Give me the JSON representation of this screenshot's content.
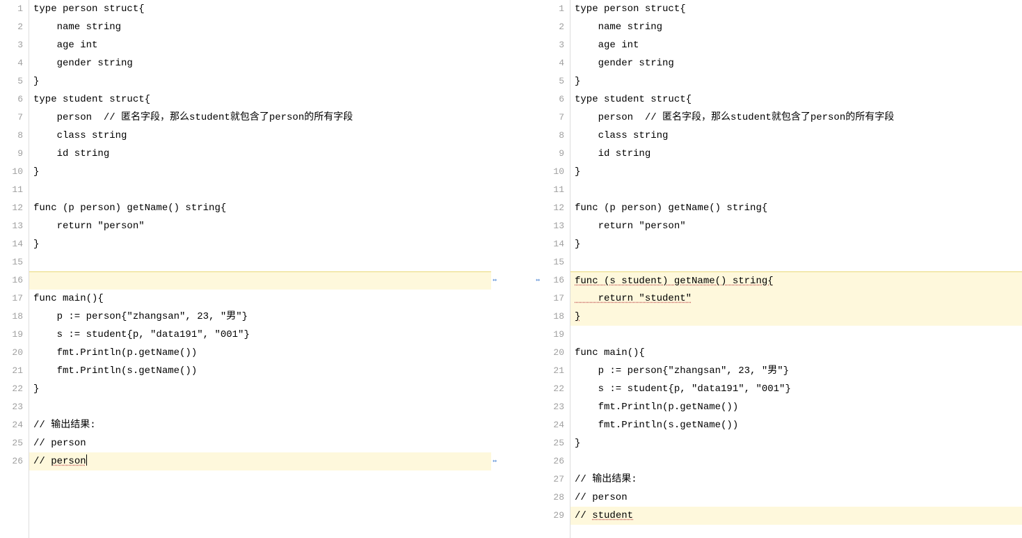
{
  "left": {
    "lines": [
      {
        "n": "1",
        "txt": "type person struct{",
        "cls": ""
      },
      {
        "n": "2",
        "txt": "    name string",
        "cls": ""
      },
      {
        "n": "3",
        "txt": "    age int",
        "cls": ""
      },
      {
        "n": "4",
        "txt": "    gender string",
        "cls": ""
      },
      {
        "n": "5",
        "txt": "}",
        "cls": ""
      },
      {
        "n": "6",
        "txt": "type student struct{",
        "cls": ""
      },
      {
        "n": "7",
        "txt": "    person  // 匿名字段，那么student就包含了person的所有字段",
        "cls": ""
      },
      {
        "n": "8",
        "txt": "    class string",
        "cls": ""
      },
      {
        "n": "9",
        "txt": "    id string",
        "cls": ""
      },
      {
        "n": "10",
        "txt": "}",
        "cls": ""
      },
      {
        "n": "11",
        "txt": "",
        "cls": ""
      },
      {
        "n": "12",
        "txt": "func (p person) getName() string{",
        "cls": ""
      },
      {
        "n": "13",
        "txt": "    return \"person\"",
        "cls": ""
      },
      {
        "n": "14",
        "txt": "}",
        "cls": ""
      },
      {
        "n": "15",
        "txt": "",
        "cls": ""
      },
      {
        "n": "16",
        "txt": "",
        "cls": "hl-yellow hl-sep-above"
      },
      {
        "n": "17",
        "txt": "func main(){",
        "cls": ""
      },
      {
        "n": "18",
        "txt": "    p := person{\"zhangsan\", 23, \"男\"}",
        "cls": ""
      },
      {
        "n": "19",
        "txt": "    s := student{p, \"data191\", \"001\"}",
        "cls": ""
      },
      {
        "n": "20",
        "txt": "    fmt.Println(p.getName())",
        "cls": ""
      },
      {
        "n": "21",
        "txt": "    fmt.Println(s.getName())",
        "cls": ""
      },
      {
        "n": "22",
        "txt": "}",
        "cls": ""
      },
      {
        "n": "23",
        "txt": "",
        "cls": ""
      },
      {
        "n": "24",
        "txt": "// 输出结果:",
        "cls": ""
      },
      {
        "n": "25",
        "txt": "// person",
        "cls": ""
      },
      {
        "n": "26",
        "txt": "",
        "cls": "hl-yellow-mod",
        "pre": "// ",
        "mod": "person",
        "caret": true
      }
    ]
  },
  "right": {
    "lines": [
      {
        "n": "1",
        "txt": "type person struct{",
        "cls": ""
      },
      {
        "n": "2",
        "txt": "    name string",
        "cls": ""
      },
      {
        "n": "3",
        "txt": "    age int",
        "cls": ""
      },
      {
        "n": "4",
        "txt": "    gender string",
        "cls": ""
      },
      {
        "n": "5",
        "txt": "}",
        "cls": ""
      },
      {
        "n": "6",
        "txt": "type student struct{",
        "cls": ""
      },
      {
        "n": "7",
        "txt": "    person  // 匿名字段，那么student就包含了person的所有字段",
        "cls": ""
      },
      {
        "n": "8",
        "txt": "    class string",
        "cls": ""
      },
      {
        "n": "9",
        "txt": "    id string",
        "cls": ""
      },
      {
        "n": "10",
        "txt": "}",
        "cls": ""
      },
      {
        "n": "11",
        "txt": "",
        "cls": ""
      },
      {
        "n": "12",
        "txt": "func (p person) getName() string{",
        "cls": ""
      },
      {
        "n": "13",
        "txt": "    return \"person\"",
        "cls": ""
      },
      {
        "n": "14",
        "txt": "}",
        "cls": ""
      },
      {
        "n": "15",
        "txt": "",
        "cls": ""
      },
      {
        "n": "16",
        "txt": "",
        "cls": "hl-yellow hl-sep-above",
        "mod": "func (s student) getName() string{"
      },
      {
        "n": "17",
        "txt": "",
        "cls": "hl-yellow",
        "mod": "    return \"student\""
      },
      {
        "n": "18",
        "txt": "",
        "cls": "hl-yellow",
        "mod": "}"
      },
      {
        "n": "19",
        "txt": "",
        "cls": ""
      },
      {
        "n": "20",
        "txt": "func main(){",
        "cls": ""
      },
      {
        "n": "21",
        "txt": "    p := person{\"zhangsan\", 23, \"男\"}",
        "cls": ""
      },
      {
        "n": "22",
        "txt": "    s := student{p, \"data191\", \"001\"}",
        "cls": ""
      },
      {
        "n": "23",
        "txt": "    fmt.Println(p.getName())",
        "cls": ""
      },
      {
        "n": "24",
        "txt": "    fmt.Println(s.getName())",
        "cls": ""
      },
      {
        "n": "25",
        "txt": "}",
        "cls": ""
      },
      {
        "n": "26",
        "txt": "",
        "cls": ""
      },
      {
        "n": "27",
        "txt": "// 输出结果:",
        "cls": ""
      },
      {
        "n": "28",
        "txt": "// person",
        "cls": ""
      },
      {
        "n": "29",
        "txt": "",
        "cls": "hl-yellow-mod",
        "pre": "// ",
        "mod": "student"
      }
    ]
  },
  "markers": {
    "glyph": "↭"
  }
}
